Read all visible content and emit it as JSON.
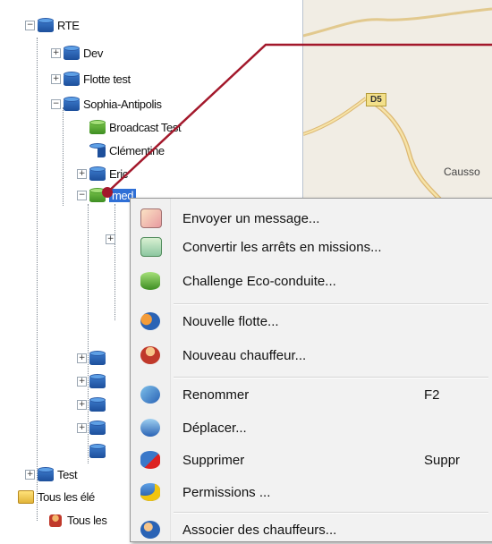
{
  "tree": {
    "items": [
      {
        "label": "RTE"
      },
      {
        "label": "Dev"
      },
      {
        "label": "Flotte test"
      },
      {
        "label": "Sophia-Antipolis"
      },
      {
        "label": "Broadcast Test"
      },
      {
        "label": "Clémentine"
      },
      {
        "label": "Eric"
      },
      {
        "label": "med"
      },
      {
        "label": "Test"
      },
      {
        "label": "Tous les élé"
      },
      {
        "label": "Tous les"
      }
    ]
  },
  "map": {
    "road_label": "D5",
    "place_label": "Causso"
  },
  "context_menu": {
    "items": [
      {
        "label": "Envoyer un message...",
        "icon": "envelope-icon"
      },
      {
        "label": "Convertir les arrêts en missions...",
        "icon": "convert-icon"
      },
      {
        "label": "Challenge Eco-conduite...",
        "icon": "eco-db-icon"
      },
      {
        "label": "Nouvelle flotte...",
        "icon": "new-fleet-icon"
      },
      {
        "label": "Nouveau chauffeur...",
        "icon": "driver-icon"
      },
      {
        "label": "Renommer",
        "shortcut": "F2",
        "icon": "rename-icon"
      },
      {
        "label": "Déplacer...",
        "icon": "move-icon"
      },
      {
        "label": "Supprimer",
        "shortcut": "Suppr",
        "icon": "delete-icon"
      },
      {
        "label": "Permissions ...",
        "icon": "permissions-icon"
      },
      {
        "label": "Associer des chauffeurs...",
        "icon": "associate-drivers-icon"
      }
    ]
  },
  "colors": {
    "callout": "#a3182b",
    "db_blue": "#1d4f9b",
    "db_green": "#4a9a2a"
  }
}
